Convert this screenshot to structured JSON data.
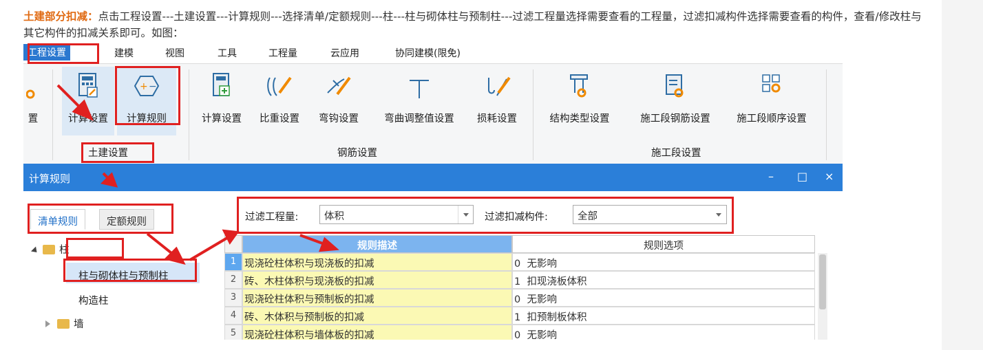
{
  "intro": {
    "highlight": "土建部分扣减：",
    "text": "点击工程设置---土建设置---计算规则---选择清单/定额规则---柱---柱与砌体柱与预制柱---过滤工程量选择需要查看的工程量，过滤扣减构件选择需要查看的构件，查看/修改柱与其它构件的扣减关系即可。如图："
  },
  "menu": [
    "工程设置",
    "建模",
    "视图",
    "工具",
    "工程量",
    "云应用",
    "协同建模(限免)"
  ],
  "ribbon": {
    "partial_label": "置",
    "tujian_buttons": [
      "计算设置",
      "计算规则"
    ],
    "tujian_group": "土建设置",
    "gangjin_buttons": [
      "计算设置",
      "比重设置",
      "弯钩设置",
      "弯曲调整值设置",
      "损耗设置"
    ],
    "gangjin_group": "钢筋设置",
    "shigong_buttons": [
      "结构类型设置",
      "施工段钢筋设置",
      "施工段顺序设置"
    ],
    "shigong_group": "施工段设置"
  },
  "window": {
    "title": "计算规则",
    "controls": [
      "–",
      "□",
      "×"
    ],
    "tabs": [
      "清单规则",
      "定额规则"
    ],
    "tree": {
      "zhu": "柱",
      "zhu_child_selected": "柱与砌体柱与预制柱",
      "gouzaozhu": "构造柱",
      "qiang": "墙"
    },
    "filter": {
      "qty_label": "过滤工程量:",
      "qty_value": "体积",
      "member_label": "过滤扣减构件:",
      "member_value": "全部"
    },
    "grid": {
      "headers": [
        "规则描述",
        "规则选项"
      ],
      "rows": [
        {
          "n": "1",
          "desc": "现浇砼柱体积与现浇板的扣减",
          "opt": "0  无影响"
        },
        {
          "n": "2",
          "desc": "砖、木柱体积与现浇板的扣减",
          "opt": "1  扣现浇板体积"
        },
        {
          "n": "3",
          "desc": "现浇砼柱体积与预制板的扣减",
          "opt": "0  无影响"
        },
        {
          "n": "4",
          "desc": "砖、木体积与预制板的扣减",
          "opt": "1  扣预制板体积"
        },
        {
          "n": "5",
          "desc": "现浇砼柱体积与墙体板的扣减",
          "opt": "0  无影响"
        }
      ]
    }
  },
  "colors": {
    "accent": "#2b7fd9",
    "annotation": "#e02020",
    "highlight": "#e06a12",
    "cell_yellow": "#fbf9b4"
  }
}
